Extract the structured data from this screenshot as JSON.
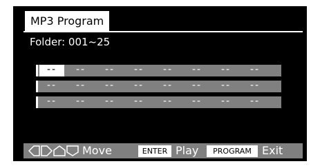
{
  "tab": {
    "title": "MP3 Program"
  },
  "folder": {
    "label": "Folder: 001~25"
  },
  "program": {
    "rows": [
      [
        "--",
        "--",
        "--",
        "--",
        "--",
        "--",
        "--",
        "--"
      ],
      [
        "--",
        "--",
        "--",
        "--",
        "--",
        "--",
        "--",
        "--"
      ],
      [
        "--",
        "--",
        "--",
        "--",
        "--",
        "--",
        "--",
        "--"
      ]
    ],
    "selected": {
      "row": 0,
      "col": 0
    }
  },
  "footer": {
    "move_icons": [
      "left-arrow-icon",
      "right-arrow-icon",
      "up-arrow-icon",
      "down-arrow-icon"
    ],
    "move_label": "Move",
    "enter_key": "ENTER",
    "enter_label": "Play",
    "program_key": "PROGRAM",
    "program_label": "Exit"
  },
  "colors": {
    "background": "#000000",
    "row": "#808080",
    "text": "#ffffff",
    "highlight": "#ffffff"
  }
}
